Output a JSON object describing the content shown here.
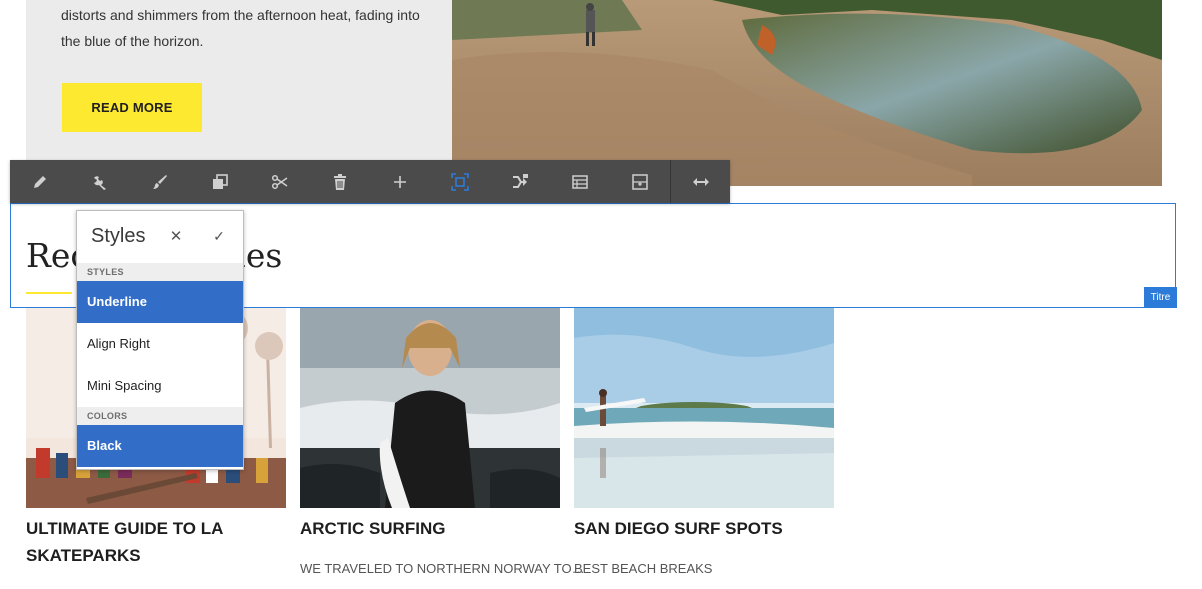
{
  "hero": {
    "text": "distorts and shimmers from the afternoon heat, fading into the blue of the horizon.",
    "button_label": "READ MORE"
  },
  "toolbar": {
    "buttons": [
      {
        "icon": "pencil-icon",
        "label": "Edit"
      },
      {
        "icon": "wrench-icon",
        "label": "Configure"
      },
      {
        "icon": "paintbrush-icon",
        "label": "Styles"
      },
      {
        "icon": "copy-icon",
        "label": "Copy"
      },
      {
        "icon": "scissors-icon",
        "label": "Cut"
      },
      {
        "icon": "trash-icon",
        "label": "Delete"
      },
      {
        "icon": "plus-icon",
        "label": "Insert"
      },
      {
        "icon": "select-icon",
        "label": "Select"
      },
      {
        "icon": "parent-icon",
        "label": "Parent"
      },
      {
        "icon": "layout-icon",
        "label": "Layout"
      },
      {
        "icon": "group-icon",
        "label": "Group"
      },
      {
        "icon": "resize-icon",
        "label": "Resize"
      }
    ],
    "active_color": "#2d7bd9"
  },
  "title_component": {
    "text": "Recent Articles",
    "badge": "Titre"
  },
  "styles_popover": {
    "title": "Styles",
    "close_symbol": "✕",
    "confirm_symbol": "✓",
    "sections": [
      {
        "heading": "STYLES",
        "items": [
          {
            "label": "Underline",
            "selected": true
          },
          {
            "label": "Align Right",
            "selected": false
          },
          {
            "label": "Mini Spacing",
            "selected": false
          }
        ]
      },
      {
        "heading": "COLORS",
        "items": [
          {
            "label": "Black",
            "selected": true
          }
        ]
      }
    ]
  },
  "cards": [
    {
      "title": "ULTIMATE GUIDE TO LA SKATEPARKS",
      "subtitle": ""
    },
    {
      "title": "ARCTIC SURFING",
      "subtitle": "WE TRAVELED TO NORTHERN NORWAY TO…"
    },
    {
      "title": "SAN DIEGO SURF SPOTS",
      "subtitle": "BEST BEACH BREAKS"
    }
  ],
  "colors": {
    "accent_yellow": "#fee931",
    "selection_blue": "#326ec8",
    "frame_blue": "#2d7bd9",
    "toolbar_bg": "#4b4b4b"
  }
}
